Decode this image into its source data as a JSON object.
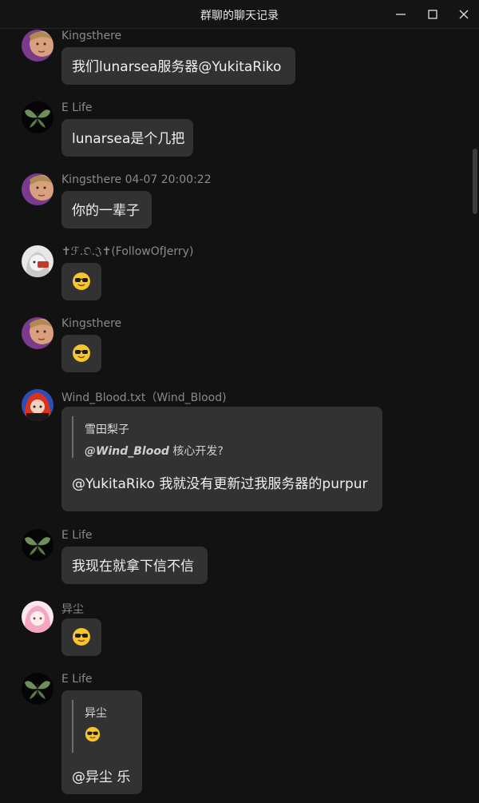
{
  "window": {
    "title": "群聊的聊天记录",
    "controls": [
      "minimize-icon",
      "maximize-icon",
      "close-icon"
    ]
  },
  "messages": [
    {
      "sender": "Kingsthere",
      "text": "我们lunarsea服务器@YukitaRiko"
    },
    {
      "sender": "E Life",
      "text": "lunarsea是个几把"
    },
    {
      "sender": "Kingsthere 04-07 20:00:22",
      "text": "你的一辈子"
    },
    {
      "sender": "✝ℱ.𝔒.𝔍✝(FollowOfJerry)",
      "emoji": "sunglasses-emoji"
    },
    {
      "sender": "Kingsthere",
      "emoji": "sunglasses-emoji"
    },
    {
      "sender": "Wind_Blood.txt（Wind_Blood)",
      "quote": {
        "name": "雪田梨子",
        "mention": "@Wind_Blood",
        "text": " 核心开发?"
      },
      "text": "@YukitaRiko 我就没有更新过我服务器的purpur"
    },
    {
      "sender": "E Life",
      "text": "我现在就拿下信不信"
    },
    {
      "sender": "异尘",
      "emoji": "sunglasses-emoji"
    },
    {
      "sender": "E Life",
      "quote": {
        "name": "异尘",
        "emoji": "sunglasses-emoji"
      },
      "text": "@异尘 乐"
    }
  ]
}
